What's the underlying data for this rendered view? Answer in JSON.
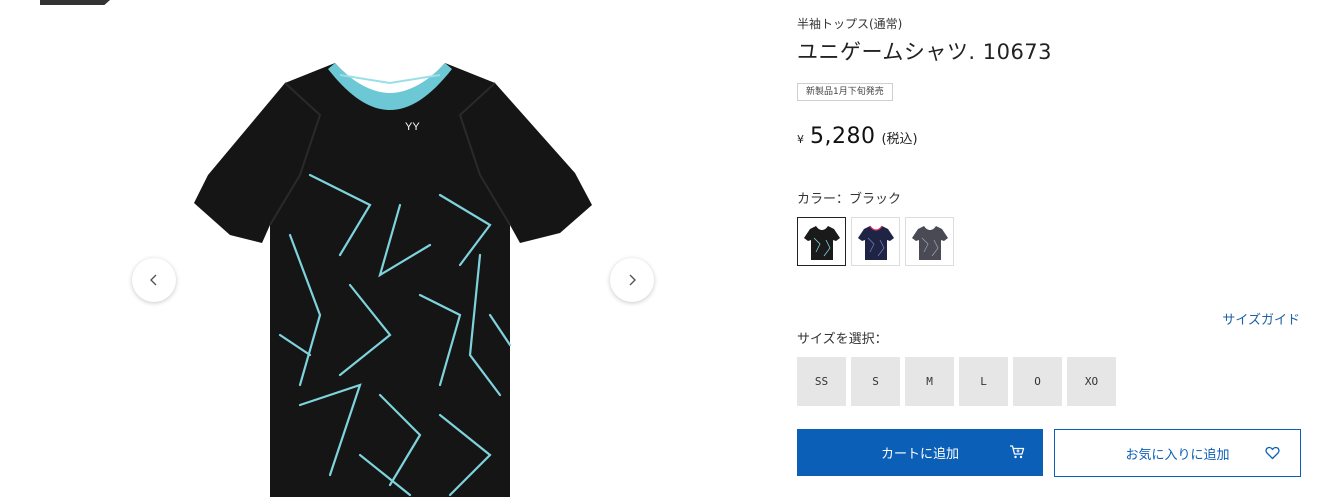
{
  "product": {
    "category": "半袖トップス(通常)",
    "name": "ユニゲームシャツ. 10673",
    "release_badge": "新製品1月下旬発売"
  },
  "price": {
    "currency": "¥",
    "amount": "5,280",
    "tax_note": "(税込)"
  },
  "color": {
    "label": "カラー：ブラック",
    "swatches": [
      {
        "name": "black",
        "hex": "#1a1a1a",
        "selected": true
      },
      {
        "name": "navy",
        "hex": "#1f2344",
        "selected": false
      },
      {
        "name": "gray",
        "hex": "#4a4a55",
        "selected": false
      }
    ]
  },
  "size": {
    "guide_link": "サイズガイド",
    "label": "サイズを選択：",
    "options": [
      "SS",
      "S",
      "M",
      "L",
      "O",
      "XO"
    ]
  },
  "actions": {
    "add_to_cart": "カートに追加",
    "add_to_favorites": "お気に入りに追加"
  },
  "icons": {
    "prev": "chevron-left-icon",
    "next": "chevron-right-icon",
    "cart": "cart-icon",
    "favorite": "heart-icon"
  },
  "colors": {
    "accent_blue": "#0b5fb7",
    "link_blue": "#1f5fa8",
    "shirt_black": "#1a1a1a",
    "pattern_aqua": "#7fd3dc",
    "size_button_bg": "#e6e6e6"
  }
}
